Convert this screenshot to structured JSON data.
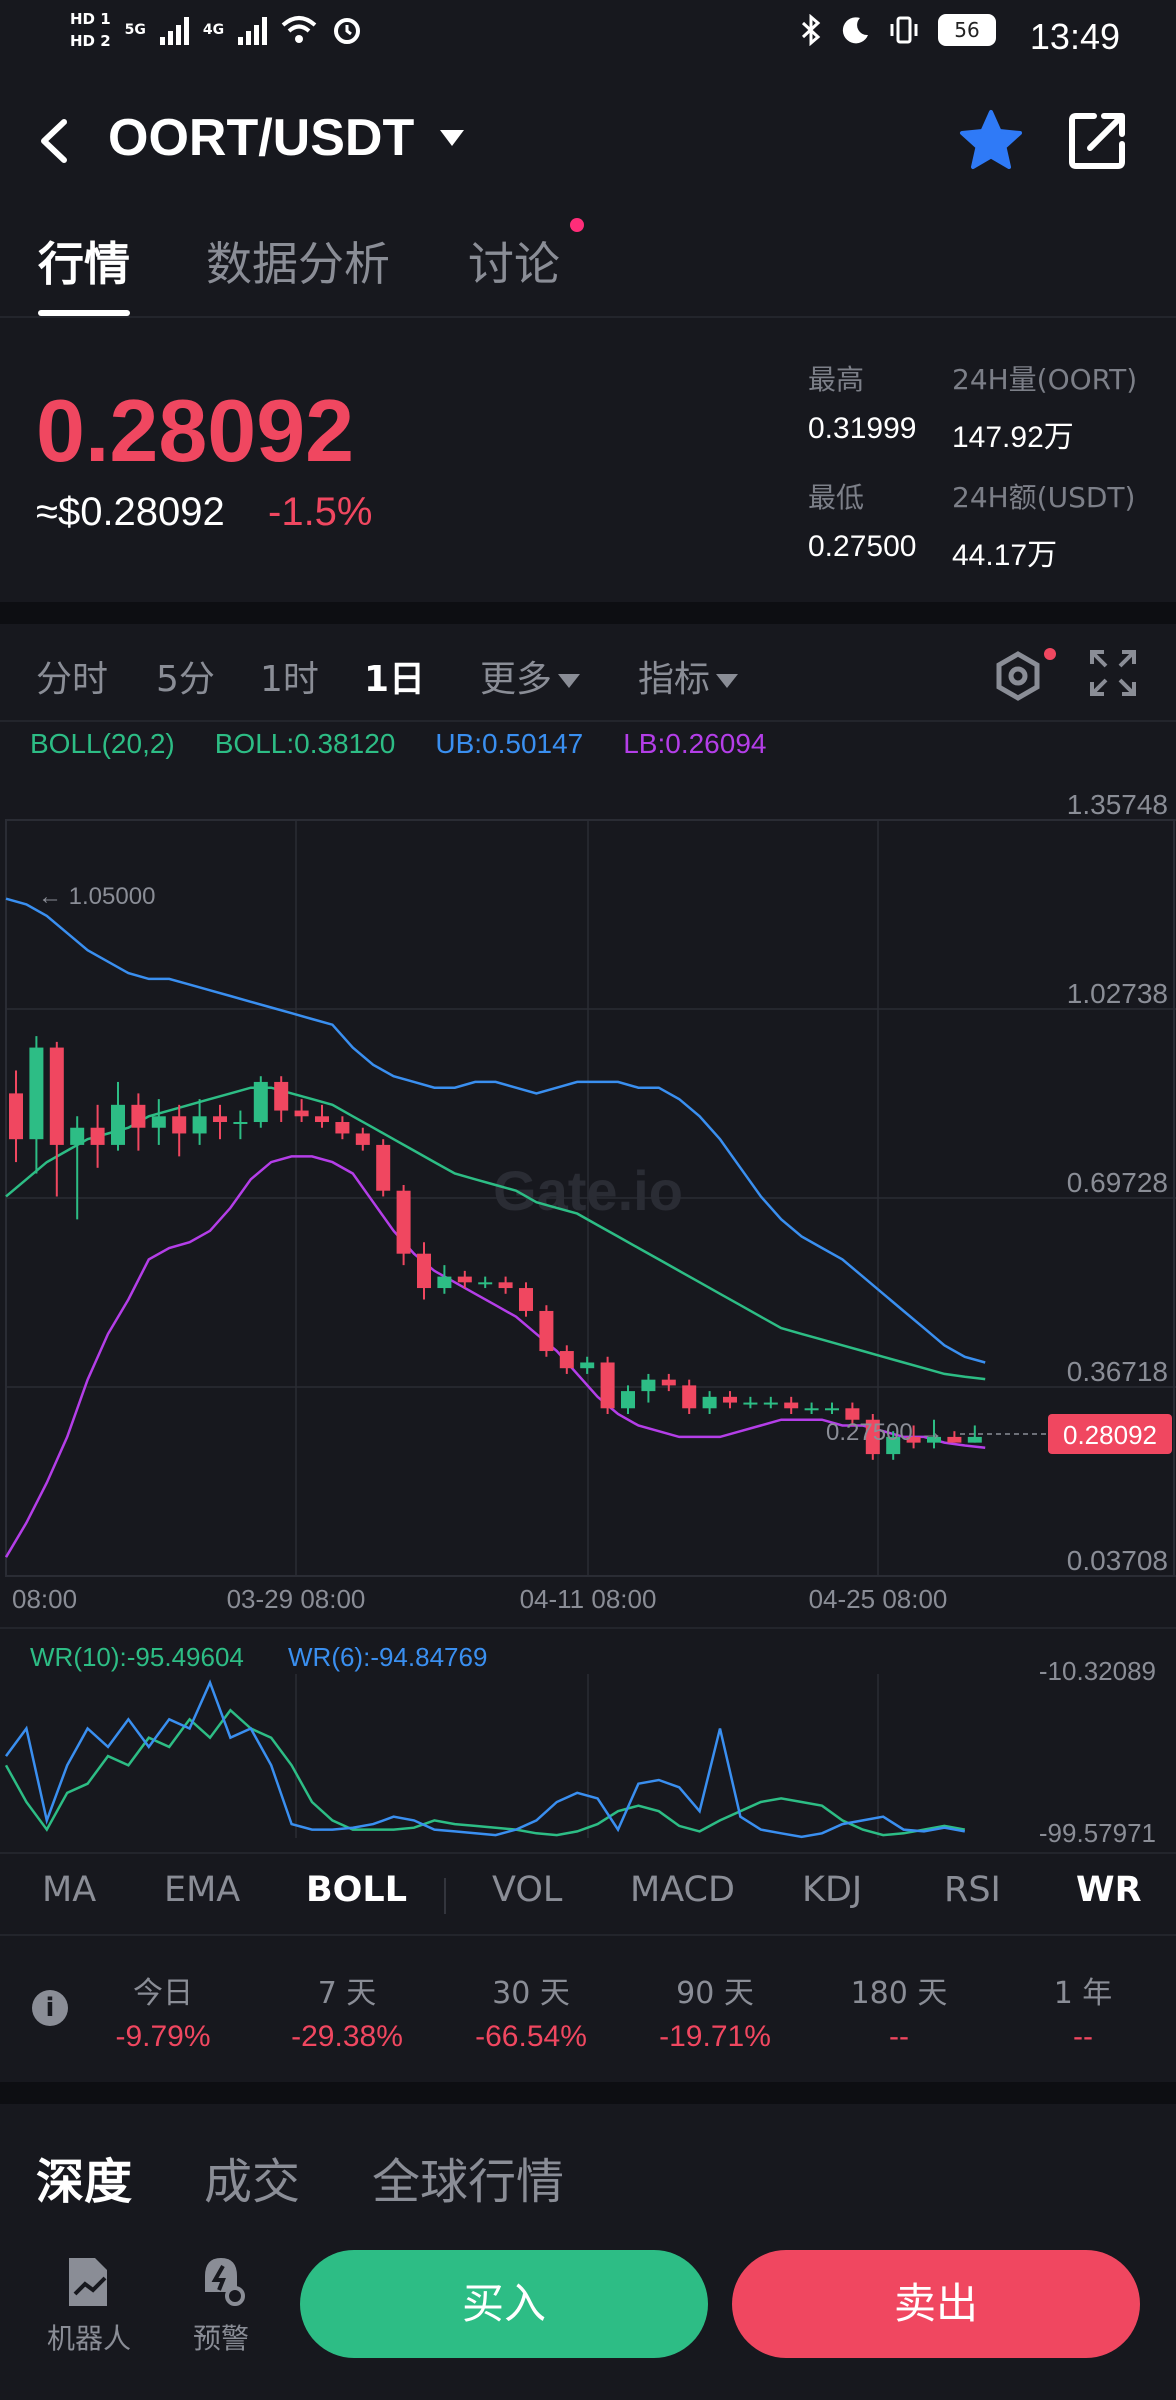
{
  "status_bar": {
    "time": "13:49",
    "hd1": "HD 1",
    "hd2": "HD 2",
    "net1": "5G",
    "net2": "4G",
    "battery": "56"
  },
  "header": {
    "pair": "OORT/USDT"
  },
  "tabs": [
    "行情",
    "数据分析",
    "讨论"
  ],
  "price": {
    "last": "0.28092",
    "usd": "≈$0.28092",
    "change": "-1.5%"
  },
  "stats": {
    "high_label": "最高",
    "high": "0.31999",
    "vol_base_label": "24H量(OORT)",
    "vol_base": "147.92万",
    "low_label": "最低",
    "low": "0.27500",
    "vol_quote_label": "24H额(USDT)",
    "vol_quote": "44.17万"
  },
  "timeframes": [
    "分时",
    "5分",
    "1时",
    "1日",
    "更多",
    "指标"
  ],
  "boll_legend": {
    "name": "BOLL(20,2)",
    "mid": "BOLL:0.38120",
    "ub": "UB:0.50147",
    "lb": "LB:0.26094"
  },
  "wr_legend": {
    "wr10": "WR(10):-95.49604",
    "wr6": "WR(6):-94.84769"
  },
  "indicator_tabs": [
    "MA",
    "EMA",
    "BOLL",
    "VOL",
    "MACD",
    "KDJ",
    "RSI",
    "WR"
  ],
  "performance": {
    "labels": [
      "今日",
      "7 天",
      "30 天",
      "90 天",
      "180 天",
      "1 年"
    ],
    "values": [
      "-9.79%",
      "-29.38%",
      "-66.54%",
      "-19.71%",
      "--",
      "--"
    ]
  },
  "bottom_tabs": [
    "深度",
    "成交",
    "全球行情"
  ],
  "bottom_bar": {
    "robot": "机器人",
    "alert": "预警",
    "buy": "买入",
    "sell": "卖出"
  },
  "colors": {
    "up": "#2dbd85",
    "down": "#f04760",
    "ub": "#3a8ff0",
    "mid": "#2dbd85",
    "lb": "#b43ee8",
    "bg": "#17181e"
  },
  "chart_data": {
    "type": "candlestick",
    "y_ticks": [
      "1.35748",
      "1.02738",
      "0.69728",
      "0.36718",
      "0.03708"
    ],
    "ylim": [
      0.03708,
      1.35748
    ],
    "x_ticks": [
      "08:00",
      "03-29 08:00",
      "04-11 08:00",
      "04-25 08:00"
    ],
    "max_marker": "1.05000",
    "min_marker": "0.27500",
    "current_price": "0.28092",
    "candles": [
      [
        0.88,
        0.8,
        0.92,
        0.76
      ],
      [
        0.8,
        0.96,
        0.98,
        0.74
      ],
      [
        0.96,
        0.79,
        0.97,
        0.7
      ],
      [
        0.79,
        0.82,
        0.84,
        0.66
      ],
      [
        0.82,
        0.79,
        0.86,
        0.75
      ],
      [
        0.79,
        0.86,
        0.9,
        0.78
      ],
      [
        0.86,
        0.82,
        0.88,
        0.78
      ],
      [
        0.82,
        0.84,
        0.87,
        0.79
      ],
      [
        0.84,
        0.81,
        0.86,
        0.77
      ],
      [
        0.81,
        0.84,
        0.87,
        0.79
      ],
      [
        0.84,
        0.83,
        0.86,
        0.8
      ],
      [
        0.83,
        0.83,
        0.85,
        0.8
      ],
      [
        0.83,
        0.9,
        0.91,
        0.82
      ],
      [
        0.9,
        0.85,
        0.91,
        0.83
      ],
      [
        0.85,
        0.84,
        0.87,
        0.83
      ],
      [
        0.84,
        0.83,
        0.86,
        0.82
      ],
      [
        0.83,
        0.81,
        0.84,
        0.8
      ],
      [
        0.81,
        0.79,
        0.82,
        0.78
      ],
      [
        0.79,
        0.71,
        0.8,
        0.7
      ],
      [
        0.71,
        0.6,
        0.72,
        0.58
      ],
      [
        0.6,
        0.54,
        0.62,
        0.52
      ],
      [
        0.54,
        0.56,
        0.58,
        0.53
      ],
      [
        0.56,
        0.55,
        0.57,
        0.54
      ],
      [
        0.55,
        0.55,
        0.56,
        0.54
      ],
      [
        0.55,
        0.54,
        0.56,
        0.53
      ],
      [
        0.54,
        0.5,
        0.55,
        0.49
      ],
      [
        0.5,
        0.43,
        0.51,
        0.42
      ],
      [
        0.43,
        0.4,
        0.44,
        0.39
      ],
      [
        0.4,
        0.41,
        0.42,
        0.39
      ],
      [
        0.41,
        0.33,
        0.42,
        0.32
      ],
      [
        0.33,
        0.36,
        0.37,
        0.32
      ],
      [
        0.36,
        0.38,
        0.39,
        0.34
      ],
      [
        0.38,
        0.37,
        0.39,
        0.36
      ],
      [
        0.37,
        0.33,
        0.38,
        0.32
      ],
      [
        0.33,
        0.35,
        0.36,
        0.32
      ],
      [
        0.35,
        0.34,
        0.36,
        0.33
      ],
      [
        0.34,
        0.34,
        0.35,
        0.33
      ],
      [
        0.34,
        0.34,
        0.35,
        0.33
      ],
      [
        0.34,
        0.33,
        0.35,
        0.32
      ],
      [
        0.33,
        0.33,
        0.34,
        0.32
      ],
      [
        0.33,
        0.33,
        0.34,
        0.32
      ],
      [
        0.33,
        0.31,
        0.34,
        0.3
      ],
      [
        0.31,
        0.25,
        0.32,
        0.24
      ],
      [
        0.25,
        0.28,
        0.29,
        0.24
      ],
      [
        0.28,
        0.27,
        0.3,
        0.26
      ],
      [
        0.27,
        0.28,
        0.31,
        0.26
      ],
      [
        0.28,
        0.27,
        0.29,
        0.27
      ],
      [
        0.27,
        0.28,
        0.3,
        0.27
      ]
    ],
    "series": [
      {
        "name": "UB",
        "values": [
          1.22,
          1.21,
          1.19,
          1.16,
          1.13,
          1.11,
          1.09,
          1.08,
          1.08,
          1.07,
          1.06,
          1.05,
          1.04,
          1.03,
          1.02,
          1.01,
          1.0,
          0.96,
          0.93,
          0.91,
          0.9,
          0.89,
          0.89,
          0.9,
          0.9,
          0.89,
          0.88,
          0.89,
          0.9,
          0.9,
          0.9,
          0.89,
          0.89,
          0.87,
          0.84,
          0.8,
          0.75,
          0.7,
          0.66,
          0.63,
          0.61,
          0.59,
          0.56,
          0.53,
          0.5,
          0.47,
          0.44,
          0.42,
          0.41
        ]
      },
      {
        "name": "MID",
        "values": [
          0.7,
          0.73,
          0.76,
          0.78,
          0.8,
          0.81,
          0.82,
          0.84,
          0.85,
          0.86,
          0.87,
          0.88,
          0.89,
          0.89,
          0.88,
          0.87,
          0.86,
          0.84,
          0.82,
          0.8,
          0.78,
          0.76,
          0.74,
          0.73,
          0.72,
          0.71,
          0.69,
          0.68,
          0.67,
          0.65,
          0.63,
          0.61,
          0.59,
          0.57,
          0.55,
          0.53,
          0.51,
          0.49,
          0.47,
          0.46,
          0.45,
          0.44,
          0.43,
          0.42,
          0.41,
          0.4,
          0.39,
          0.385,
          0.381
        ]
      },
      {
        "name": "LB",
        "values": [
          0.07,
          0.13,
          0.2,
          0.28,
          0.38,
          0.46,
          0.52,
          0.59,
          0.61,
          0.62,
          0.64,
          0.68,
          0.73,
          0.76,
          0.77,
          0.77,
          0.76,
          0.74,
          0.69,
          0.64,
          0.6,
          0.57,
          0.55,
          0.53,
          0.51,
          0.49,
          0.46,
          0.43,
          0.39,
          0.35,
          0.32,
          0.3,
          0.29,
          0.28,
          0.28,
          0.28,
          0.29,
          0.3,
          0.31,
          0.31,
          0.31,
          0.3,
          0.3,
          0.29,
          0.28,
          0.28,
          0.27,
          0.265,
          0.261
        ]
      }
    ],
    "wr": {
      "ylim": [
        -99.57971,
        -10.32089
      ],
      "y_ticks": [
        "-10.32089",
        "-99.57971"
      ],
      "wr10": [
        -60,
        -80,
        -95,
        -75,
        -70,
        -55,
        -60,
        -45,
        -50,
        -35,
        -45,
        -30,
        -40,
        -45,
        -60,
        -80,
        -90,
        -95,
        -95,
        -95,
        -94,
        -90,
        -92,
        -93,
        -94,
        -95,
        -97,
        -98,
        -96,
        -92,
        -85,
        -82,
        -85,
        -93,
        -96,
        -90,
        -85,
        -80,
        -78,
        -80,
        -82,
        -90,
        -95,
        -98,
        -97,
        -95,
        -93,
        -95
      ],
      "wr6": [
        -55,
        -40,
        -90,
        -60,
        -40,
        -50,
        -35,
        -50,
        -35,
        -40,
        -15,
        -45,
        -40,
        -60,
        -92,
        -95,
        -95,
        -94,
        -92,
        -88,
        -90,
        -95,
        -96,
        -97,
        -98,
        -95,
        -90,
        -80,
        -75,
        -78,
        -95,
        -70,
        -68,
        -72,
        -85,
        -40,
        -88,
        -95,
        -97,
        -99,
        -97,
        -92,
        -90,
        -88,
        -95,
        -96,
        -94,
        -96
      ]
    }
  }
}
